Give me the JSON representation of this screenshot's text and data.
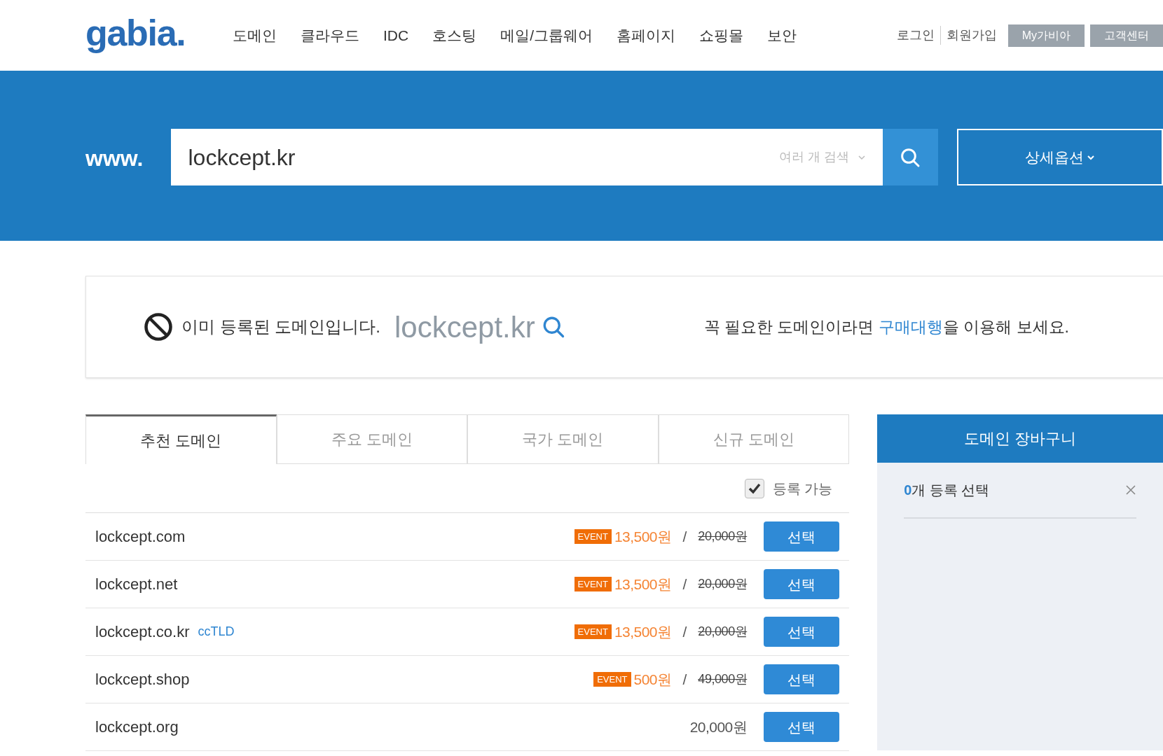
{
  "header": {
    "logo": "gabia.",
    "nav": [
      "도메인",
      "클라우드",
      "IDC",
      "호스팅",
      "메일/그룹웨어",
      "홈페이지",
      "쇼핑몰",
      "보안"
    ],
    "links": [
      "로그인",
      "회원가입"
    ],
    "buttons": [
      "My가비아",
      "고객센터"
    ]
  },
  "search": {
    "prefix": "www.",
    "value": "lockcept.kr",
    "multi": "여러 개 검색",
    "options": "상세옵션"
  },
  "notice": {
    "message": "이미 등록된 도메인입니다.",
    "domain": "lockcept.kr",
    "hint_before": "꼭 필요한 도메인이라면 ",
    "hint_link": "구매대행",
    "hint_after": "을 이용해 보세요."
  },
  "tabs": [
    {
      "label": "추천 도메인",
      "selected": true
    },
    {
      "label": "주요 도메인",
      "selected": false
    },
    {
      "label": "국가 도메인",
      "selected": false
    },
    {
      "label": "신규 도메인",
      "selected": false
    }
  ],
  "filter": {
    "label": "등록 가능",
    "checked": true
  },
  "rows": [
    {
      "domain": "lockcept.com",
      "badge": "EVENT",
      "price": "13,500원",
      "sep": "/",
      "original": "20,000원",
      "button": "선택"
    },
    {
      "domain": "lockcept.net",
      "badge": "EVENT",
      "price": "13,500원",
      "sep": "/",
      "original": "20,000원",
      "button": "선택"
    },
    {
      "domain": "lockcept.co.kr",
      "tag": "ccTLD",
      "badge": "EVENT",
      "price": "13,500원",
      "sep": "/",
      "original": "20,000원",
      "button": "선택"
    },
    {
      "domain": "lockcept.shop",
      "badge": "EVENT",
      "price": "500원",
      "sep": "/",
      "original": "49,000원",
      "button": "선택"
    },
    {
      "domain": "lockcept.org",
      "regular": "20,000원",
      "button": "선택"
    }
  ],
  "cart": {
    "title": "도메인 장바구니",
    "count": "0",
    "count_label": "개 등록 선택"
  }
}
